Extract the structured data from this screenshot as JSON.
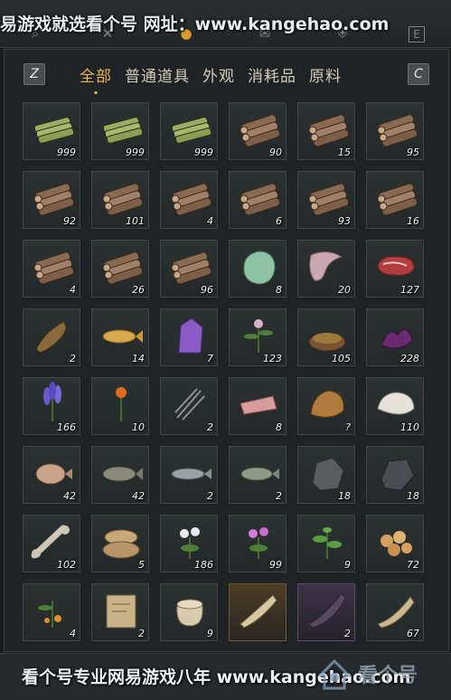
{
  "watermark_top": "易游戏就选看个号  网址：www.kangehao.com",
  "watermark_bottom": "看个号专业网易游戏八年  www.kangehao.com",
  "brand_logo_text": "看个号",
  "top_icons": [
    "search-icon",
    "cross-icon",
    "pouch-icon",
    "mail-icon",
    "shield-icon",
    "e-key-icon"
  ],
  "key_left": "Z",
  "key_right": "C",
  "tabs": [
    "全部",
    "普通道具",
    "外观",
    "消耗品",
    "原料"
  ],
  "active_tab": 0,
  "colors": {
    "accent": "#e3b55a",
    "qty_text": "#f2f2f2"
  },
  "items": [
    {
      "icon": "bamboo-bundle-icon",
      "qty": "999"
    },
    {
      "icon": "bamboo-bundle-icon",
      "qty": "999"
    },
    {
      "icon": "bamboo-bundle-icon",
      "qty": "999"
    },
    {
      "icon": "log-pile-icon",
      "qty": "90"
    },
    {
      "icon": "log-pile-icon",
      "qty": "15"
    },
    {
      "icon": "log-pile-icon",
      "qty": "95"
    },
    {
      "icon": "log-pile-icon",
      "qty": "92"
    },
    {
      "icon": "log-pile-icon",
      "qty": "101"
    },
    {
      "icon": "log-pile-icon",
      "qty": "4"
    },
    {
      "icon": "log-pile-icon",
      "qty": "6"
    },
    {
      "icon": "log-pile-icon",
      "qty": "93"
    },
    {
      "icon": "log-pile-icon",
      "qty": "16"
    },
    {
      "icon": "log-pile-icon",
      "qty": "4"
    },
    {
      "icon": "log-pile-icon",
      "qty": "26"
    },
    {
      "icon": "log-pile-icon",
      "qty": "96"
    },
    {
      "icon": "jade-stone-icon",
      "qty": "8"
    },
    {
      "icon": "raw-meat-strip-icon",
      "qty": "20"
    },
    {
      "icon": "steak-icon",
      "qty": "127"
    },
    {
      "icon": "catfish-icon",
      "qty": "2"
    },
    {
      "icon": "golden-carp-icon",
      "qty": "14"
    },
    {
      "icon": "amethyst-crystal-icon",
      "qty": "7"
    },
    {
      "icon": "herb-flower-icon",
      "qty": "123"
    },
    {
      "icon": "spice-bowl-icon",
      "qty": "105"
    },
    {
      "icon": "purple-petals-icon",
      "qty": "228"
    },
    {
      "icon": "lavender-icon",
      "qty": "166"
    },
    {
      "icon": "orange-flower-icon",
      "qty": "10"
    },
    {
      "icon": "dry-grass-icon",
      "qty": "2"
    },
    {
      "icon": "raw-fillet-icon",
      "qty": "8"
    },
    {
      "icon": "brown-fur-icon",
      "qty": "?"
    },
    {
      "icon": "white-fur-icon",
      "qty": "110"
    },
    {
      "icon": "pufferfish-icon",
      "qty": "42"
    },
    {
      "icon": "spotted-fish-icon",
      "qty": "42"
    },
    {
      "icon": "gray-fish-icon",
      "qty": "2"
    },
    {
      "icon": "perch-icon",
      "qty": "2"
    },
    {
      "icon": "iron-ore-icon",
      "qty": "18"
    },
    {
      "icon": "dark-ore-icon",
      "qty": "18"
    },
    {
      "icon": "bone-icon",
      "qty": "102"
    },
    {
      "icon": "grain-sacks-icon",
      "qty": "5"
    },
    {
      "icon": "white-flower-icon",
      "qty": "186"
    },
    {
      "icon": "pink-flower-icon",
      "qty": "99"
    },
    {
      "icon": "green-herb-icon",
      "qty": "9"
    },
    {
      "icon": "amber-nuggets-icon",
      "qty": "72"
    },
    {
      "icon": "orange-fruit-plant-icon",
      "qty": "4"
    },
    {
      "icon": "parchment-scroll-icon",
      "qty": "2"
    },
    {
      "icon": "clay-jar-icon",
      "qty": "9"
    },
    {
      "icon": "golden-horn-icon",
      "qty": ""
    },
    {
      "icon": "purple-horn-icon",
      "qty": "2"
    },
    {
      "icon": "brass-horn-icon",
      "qty": "67"
    }
  ]
}
